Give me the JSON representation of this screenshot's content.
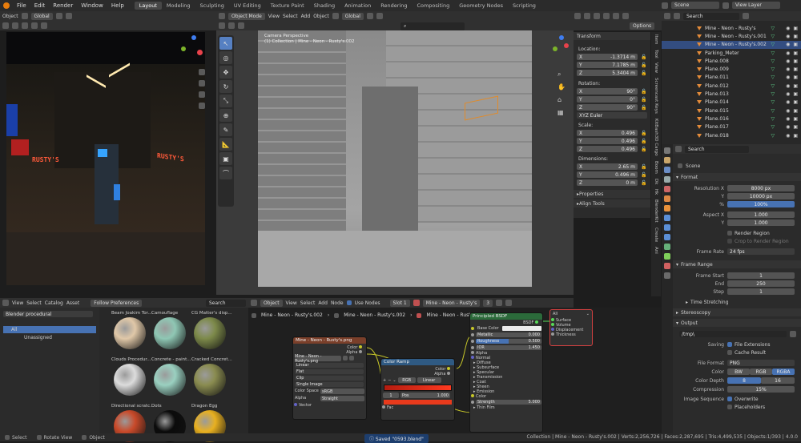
{
  "menu": [
    "File",
    "Edit",
    "Render",
    "Window",
    "Help"
  ],
  "workspaces": [
    "Layout",
    "Modeling",
    "Sculpting",
    "UV Editing",
    "Texture Paint",
    "Shading",
    "Animation",
    "Rendering",
    "Compositing",
    "Geometry Nodes",
    "Scripting"
  ],
  "scene_name": "Scene",
  "view_layer": "View Layer",
  "left_header": {
    "mode": "Object",
    "orient": "Global"
  },
  "viewport_header": {
    "mode": "Object Mode",
    "view": "View",
    "select": "Select",
    "add": "Add",
    "object": "Object",
    "orient": "Global",
    "options": "Options"
  },
  "viewport": {
    "camera_label": "Camera Perspective",
    "collection_label": "(1) Collection | Mine - Neon - Rusty's.002"
  },
  "render_preview": {
    "sign_left": "RUSTY'S",
    "sign_right": "RUSTY'S"
  },
  "transform": {
    "title": "Transform",
    "location_label": "Location:",
    "loc": [
      {
        "axis": "X",
        "value": "-1.3714 m"
      },
      {
        "axis": "Y",
        "value": "7.1785 m"
      },
      {
        "axis": "Z",
        "value": "5.3404 m"
      }
    ],
    "rotation_label": "Rotation:",
    "rot": [
      {
        "axis": "X",
        "value": "90°"
      },
      {
        "axis": "Y",
        "value": "0°"
      },
      {
        "axis": "Z",
        "value": "90°"
      }
    ],
    "euler": "XYZ Euler",
    "scale_label": "Scale:",
    "scale": [
      {
        "axis": "X",
        "value": "0.496"
      },
      {
        "axis": "Y",
        "value": "0.496"
      },
      {
        "axis": "Z",
        "value": "0.496"
      }
    ],
    "dimensions_label": "Dimensions:",
    "dim": [
      {
        "axis": "X",
        "value": "2.65 m"
      },
      {
        "axis": "Y",
        "value": "0.496 m"
      },
      {
        "axis": "Z",
        "value": "0 m"
      }
    ],
    "properties": "Properties",
    "align_tools": "Align Tools"
  },
  "side_tabs": [
    "Item",
    "Tool",
    "View",
    "Screencast Keys",
    "KitBash3D Cargo",
    "Boom",
    "Dk",
    "Hk",
    "BlenderKit",
    "Create",
    "Ani"
  ],
  "outliner": {
    "search_placeholder": "Search",
    "items": [
      "Mine - Neon - Rusty's",
      "Mine - Neon - Rusty's.001",
      "Mine - Neon - Rusty's.002",
      "Parking_Meter",
      "Plane.008",
      "Plane.009",
      "Plane.011",
      "Plane.012",
      "Plane.013",
      "Plane.014",
      "Plane.015",
      "Plane.016",
      "Plane.017",
      "Plane.018"
    ],
    "selected_index": 2
  },
  "properties": {
    "search_placeholder": "Search",
    "scene": "Scene",
    "format_title": "Format",
    "resolution_x_label": "Resolution X",
    "resolution_x": "8000 px",
    "resolution_y_label": "Y",
    "resolution_y": "10000 px",
    "percent_label": "%",
    "percent": "100%",
    "aspect_x_label": "Aspect X",
    "aspect_x": "1.000",
    "aspect_y_label": "Y",
    "aspect_y": "1.000",
    "render_region": "Render Region",
    "crop": "Crop to Render Region",
    "frame_rate_label": "Frame Rate",
    "frame_rate": "24 fps",
    "frame_range_title": "Frame Range",
    "frame_start_label": "Frame Start",
    "frame_start": "1",
    "end_label": "End",
    "end": "250",
    "step_label": "Step",
    "step": "1",
    "time_stretching": "Time Stretching",
    "stereoscopy": "Stereoscopy",
    "output_title": "Output",
    "output_path": "/tmp\\",
    "saving_label": "Saving",
    "file_extensions": "File Extensions",
    "cache_result": "Cache Result",
    "file_format_label": "File Format",
    "file_format": "PNG",
    "color_label": "Color",
    "color_options": [
      "BW",
      "RGB",
      "RGBA"
    ],
    "color_depth_label": "Color Depth",
    "depth_options": [
      "8",
      "16"
    ],
    "compression_label": "Compression",
    "compression": "15%",
    "image_sequence_label": "Image Sequence",
    "overwrite": "Overwrite",
    "placeholders": "Placeholders"
  },
  "asset_browser": {
    "header": [
      "View",
      "Select",
      "Catalog",
      "Asset"
    ],
    "follow_prefs": "Follow Preferences",
    "library": "Blender procedural",
    "search_placeholder": "Search",
    "catalogs": [
      "All",
      "Unassigned"
    ],
    "assets": [
      {
        "name": "Beam Joakim Tor...",
        "color": "#e0c8a8"
      },
      {
        "name": "Camouflage",
        "color": "#8fc7b4"
      },
      {
        "name": "CG Matter's disp...",
        "color": "#7d8a4a"
      },
      {
        "name": "Clouds Procedur...",
        "color": "#dcdcdc"
      },
      {
        "name": "Concrete - paint...",
        "color": "#9ad0c0"
      },
      {
        "name": "Cracked Concret...",
        "color": "#8a8c50"
      },
      {
        "name": "Directional scratc...",
        "color": "#c94a2a"
      },
      {
        "name": "Dots",
        "color": "#0b0b0b"
      },
      {
        "name": "Dragon Egg",
        "color": "#e8b020"
      }
    ]
  },
  "node_editor": {
    "header": [
      "Object",
      "View",
      "Select",
      "Add",
      "Node"
    ],
    "use_nodes": "Use Nodes",
    "slot": "Slot 1",
    "material": "Mine - Neon - Rusty's",
    "users": "3",
    "breadcrumb": [
      "Mine - Neon - Rusty's.002",
      "Mine - Neon - Rusty's.002",
      "Mine - Neon - Rusty's"
    ],
    "image_node": {
      "title": "Mine - Neon - Rusty's.png",
      "image": "Mine - Neon - Rusty's.png",
      "outputs": [
        "Color",
        "Alpha"
      ],
      "opts": [
        "Linear",
        "Flat",
        "Clip",
        "Single Image"
      ],
      "color_space_label": "Color Space",
      "color_space": "sRGB",
      "alpha_label": "Alpha",
      "alpha": "Straight",
      "vector": "Vector"
    },
    "ramp_node": {
      "title": "Color Ramp",
      "outputs": [
        "Color",
        "Alpha"
      ],
      "mode": "RGB",
      "interp": "Linear",
      "pos_index": "1",
      "pos_label": "Pos",
      "pos": "1.000",
      "fac": "Fac"
    },
    "bsdf_node": {
      "title": "Principled BSDF",
      "output": "BSDF",
      "base_color": "Base Color",
      "metallic_label": "Metallic",
      "metallic": "0.000",
      "roughness_label": "Roughness",
      "roughness": "0.500",
      "ior_label": "IOR",
      "ior": "1.450",
      "inputs": [
        "Alpha",
        "Normal",
        "Diffuse",
        "Subsurface",
        "Specular",
        "Transmission",
        "Coat",
        "Sheen",
        "Emission"
      ],
      "color_label": "Color",
      "strength_label": "Strength",
      "strength": "5.000",
      "thin_film": "Thin Film"
    },
    "output_node": {
      "target": "All",
      "inputs": [
        "Surface",
        "Volume",
        "Displacement",
        "Thickness"
      ]
    }
  },
  "status_bar": {
    "left": [
      "Select",
      "Rotate View",
      "Object"
    ],
    "saved": "Saved \"0593.blend\"",
    "right": "Collection | Mine - Neon - Rusty's.002 | Verts:2,256,726 | Faces:2,287,695 | Tris:4,499,535 | Objects:1/393 | 4.0.0"
  }
}
